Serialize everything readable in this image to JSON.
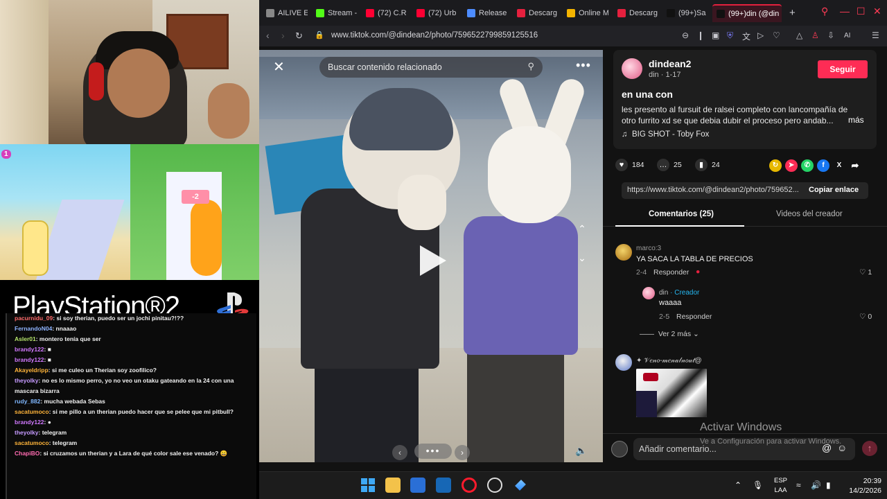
{
  "stream": {
    "game_hud": "1",
    "game_gate": "-2",
    "ps2_logo": "PlayStation®2",
    "chat": [
      {
        "user": "pacurnidu_09",
        "msg": ": si soy therian, puedo ser un jochi pinitau?!??",
        "color": "#ff6b6b"
      },
      {
        "user": "FernandoN04",
        "msg": ": nnaaao",
        "color": "#8fb4ff"
      },
      {
        "user": "Asler01",
        "msg": ": montero tenía que ser",
        "color": "#b5e36b"
      },
      {
        "user": "brandy122",
        "msg": ": ■",
        "color": "#d179ff"
      },
      {
        "user": "brandy122",
        "msg": ": ■",
        "color": "#d179ff"
      },
      {
        "user": "Akayeldripp",
        "msg": ": si me culeo un Therian soy zoofilico?",
        "color": "#ffb43a"
      },
      {
        "user": "theyolky",
        "msg": ": no es lo mismo perro, yo no veo un otaku gateando en la 24 con una mascara bizarra",
        "color": "#c69bff"
      },
      {
        "user": "rudy_882",
        "msg": ": mucha webada Sebas",
        "color": "#7fb7ff"
      },
      {
        "user": "sacatumoco",
        "msg": ": si me pillo a un therian puedo hacer que se pelee que mi pitbull?",
        "color": "#ffb43a"
      },
      {
        "user": "brandy122",
        "msg": ": ●",
        "color": "#d179ff"
      },
      {
        "user": "theyolky",
        "msg": ": telegram",
        "color": "#c69bff"
      },
      {
        "user": "sacatumoco",
        "msg": ": telegram",
        "color": "#ffb43a"
      },
      {
        "user": "ChapiBO",
        "msg": ": si cruzamos un therian y a Lara de qué color sale ese venado? 😀",
        "color": "#ff6bb0"
      }
    ]
  },
  "browser": {
    "tabs": [
      {
        "label": "AILIVE E",
        "icon_color": "#888"
      },
      {
        "label": "Stream -",
        "icon_color": "#53fc18"
      },
      {
        "label": "(72) C.R",
        "icon_color": "#ff0033"
      },
      {
        "label": "(72) Urb",
        "icon_color": "#ff0033"
      },
      {
        "label": "Release",
        "icon_color": "#4d8cff"
      },
      {
        "label": "Descarg",
        "icon_color": "#e5203e"
      },
      {
        "label": "Online M",
        "icon_color": "#f4b400"
      },
      {
        "label": "Descarg",
        "icon_color": "#e5203e"
      },
      {
        "label": "(99+)Sa",
        "icon_color": "#111"
      },
      {
        "label": "(99+)din (@din",
        "icon_color": "#111",
        "active": true
      }
    ],
    "url": "www.tiktok.com/@dindean2/photo/7596522799859125516",
    "accent": "#ff3b55"
  },
  "viewer": {
    "search_placeholder": "Buscar contenido relacionado",
    "more_label": "•••",
    "carousel_label": "•••"
  },
  "post": {
    "author": "dindean2",
    "author_sub": "din · 1-17",
    "follow_label": "Seguir",
    "title": "en una con",
    "description": "les presento al fursuit de ralsei completo con lancompañía de otro furrito xd se que debia dubir el proceso pero andab...",
    "more_label": "más",
    "music": "BIG SHOT - Toby Fox",
    "likes": "184",
    "comments_count": "25",
    "saves": "24",
    "link": "https://www.tiktok.com/@dindean2/photo/759652...",
    "copy_label": "Copiar enlace",
    "accent": "#fe2c55"
  },
  "panel_tabs": {
    "comments": "Comentarios (25)",
    "creator_videos": "Videos del creador"
  },
  "comments": [
    {
      "user": "marco:3",
      "text": "YA SACA LA TABLA DE PRECIOS",
      "date": "2-4",
      "reply": "Responder",
      "likes": "1"
    },
    {
      "user": "din",
      "badge": "· Creador",
      "text": "waaaa",
      "date": "2-5",
      "reply": "Responder",
      "likes": "0"
    },
    {
      "user": "✦ 𝒱𝑒𝓃𝑜-𝓂𝑒𝓃𝒶𝓁𝓃𝑜𝓊𝓉@",
      "text": "",
      "date": "",
      "reply": "",
      "likes": ""
    }
  ],
  "view_more": "Ver 2 más",
  "comment_input_placeholder": "Añadir comentario...",
  "windows": {
    "activate": "Activar Windows",
    "activate_sub": "Ve a Configuración para activar Windows."
  },
  "taskbar": {
    "lang_1": "ESP",
    "lang_2": "LAA",
    "time": "20:39",
    "date": "14/2/2026"
  }
}
